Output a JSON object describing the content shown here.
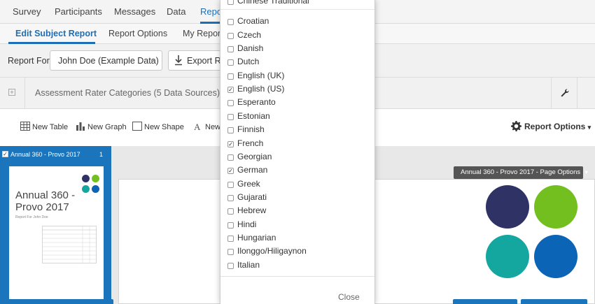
{
  "topnav": {
    "tabs": [
      "Survey",
      "Participants",
      "Messages",
      "Data",
      "Repor"
    ]
  },
  "subnav": {
    "tabs": [
      "Edit Subject Report",
      "Report Options",
      "My Reports"
    ]
  },
  "report_bar": {
    "report_for_label": "Report For",
    "selected_subject": "John Doe (Example Data)",
    "export_label": "Export Re"
  },
  "rater_bar": {
    "title": "Assessment Rater Categories (5 Data Sources)",
    "expander_glyph": "+"
  },
  "toolbar": {
    "new_table": "New Table",
    "new_graph": "New Graph",
    "new_shape": "New Shape",
    "new_text": "New",
    "report_options": "Report Options"
  },
  "thumbnail": {
    "title": "Annual 360 - Provo 2017",
    "page_number": "1",
    "page_title": "Annual 360 - Provo 2017",
    "page_subtitle": "Report For John Doe"
  },
  "page_options_label": "Annual 360 - Provo 2017 - Page Options",
  "language_dropdown": {
    "languages": [
      {
        "label": "Chinese Traditional",
        "checked": false
      },
      {
        "label": "Croatian",
        "checked": false
      },
      {
        "label": "Czech",
        "checked": false
      },
      {
        "label": "Danish",
        "checked": false
      },
      {
        "label": "Dutch",
        "checked": false
      },
      {
        "label": "English (UK)",
        "checked": false
      },
      {
        "label": "English (US)",
        "checked": true
      },
      {
        "label": "Esperanto",
        "checked": false
      },
      {
        "label": "Estonian",
        "checked": false
      },
      {
        "label": "Finnish",
        "checked": false
      },
      {
        "label": "French",
        "checked": true
      },
      {
        "label": "Georgian",
        "checked": false
      },
      {
        "label": "German",
        "checked": true
      },
      {
        "label": "Greek",
        "checked": false
      },
      {
        "label": "Gujarati",
        "checked": false
      },
      {
        "label": "Hebrew",
        "checked": false
      },
      {
        "label": "Hindi",
        "checked": false
      },
      {
        "label": "Hungarian",
        "checked": false
      },
      {
        "label": "Ilonggo/Hiligaynon",
        "checked": false
      },
      {
        "label": "Italian",
        "checked": false
      }
    ],
    "close_label": "Close"
  },
  "colors": {
    "accent": "#1c6fb7",
    "navy": "#2e3264",
    "lime": "#72bf1f",
    "teal": "#14a7a0",
    "blue": "#0b64b5"
  }
}
